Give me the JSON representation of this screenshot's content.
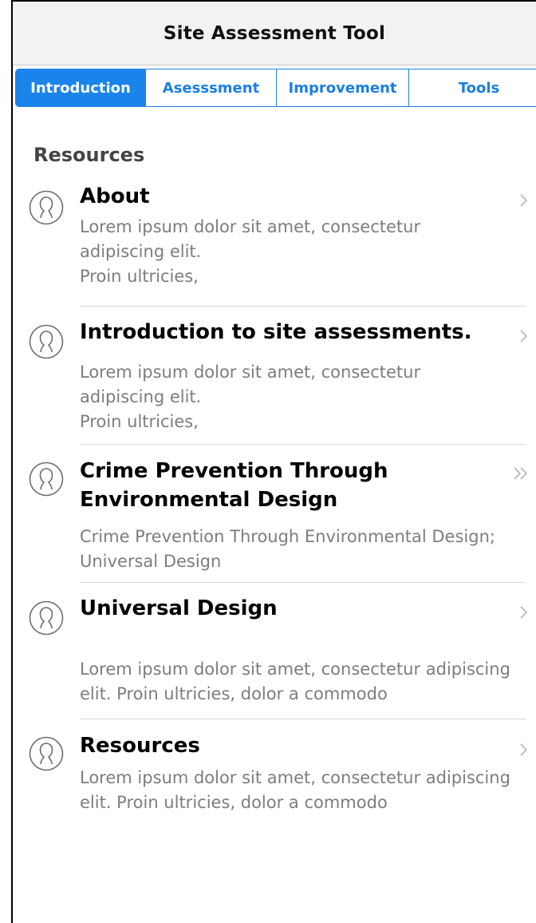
{
  "header": {
    "title": "Site Assessment Tool"
  },
  "tabs": [
    {
      "label": "Introduction",
      "active": true
    },
    {
      "label": "Asesssment",
      "active": false
    },
    {
      "label": "Improvement",
      "active": false
    },
    {
      "label": "Tools",
      "active": false
    }
  ],
  "section": {
    "title": "Resources"
  },
  "items": [
    {
      "title": "About",
      "desc": "Lorem ipsum dolor sit amet, consectetur adipiscing elit.",
      "desc2": "Proin ultricies,",
      "icon": "user-icon",
      "chevron": "chevron-right-icon"
    },
    {
      "title": "Introduction to site assessments.",
      "desc": "Lorem ipsum dolor sit amet, consectetur adipiscing elit.",
      "desc2": "Proin ultricies,",
      "icon": "user-icon",
      "chevron": "chevron-right-icon"
    },
    {
      "title": "Crime Prevention Through Environmental Design",
      "desc": "Crime Prevention Through Environmental Design; Universal Design",
      "icon": "user-icon",
      "chevron": "double-chevron-right-icon"
    },
    {
      "title": "Universal Design",
      "desc": "Lorem ipsum dolor sit amet, consectetur adipiscing elit. Proin ultricies, dolor a commodo",
      "icon": "user-icon",
      "chevron": "chevron-right-icon"
    },
    {
      "title": "Resources",
      "desc": "Lorem ipsum dolor sit amet, consectetur adipiscing elit. Proin ultricies, dolor a commodo",
      "icon": "user-icon",
      "chevron": "chevron-right-icon"
    }
  ],
  "colors": {
    "accent": "#1a84ea",
    "header_bg": "#f2f2f2",
    "desc_text": "#7d7d7d",
    "section_text": "#444444"
  }
}
